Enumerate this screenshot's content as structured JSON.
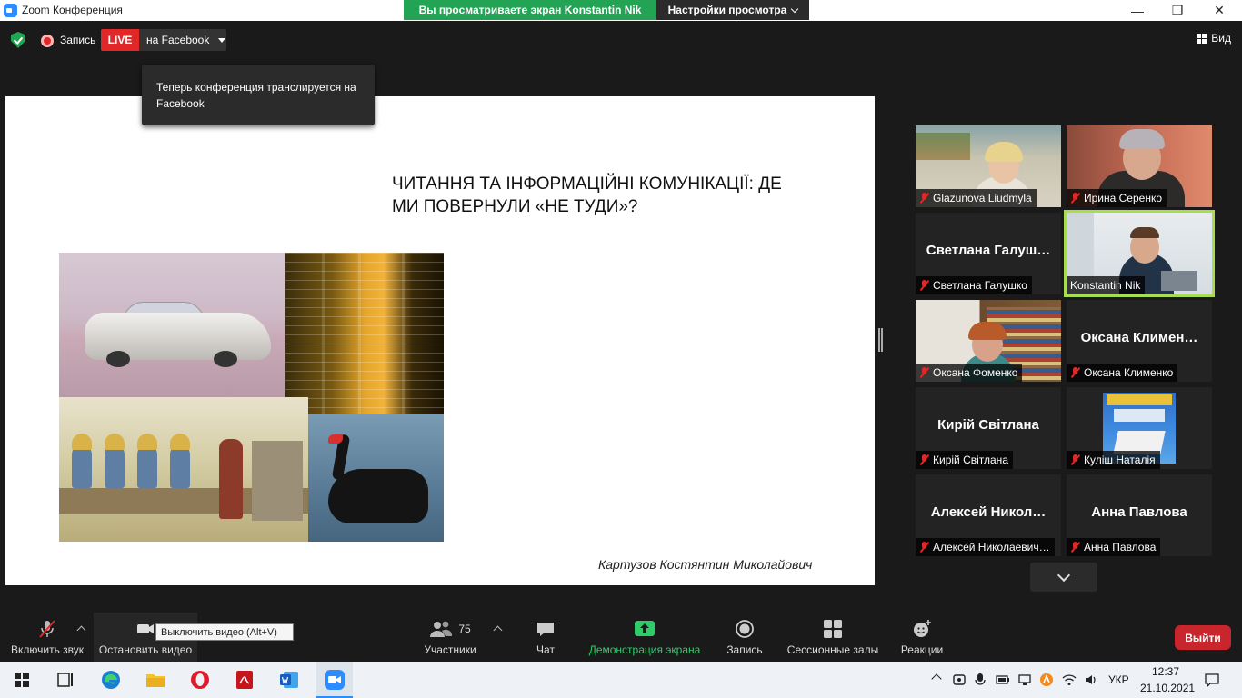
{
  "window": {
    "title": "Zoom Конференция"
  },
  "share_banner": {
    "viewing": "Вы просматриваете экран Konstantin Nik",
    "view_settings": "Настройки просмотра"
  },
  "window_controls": {
    "minimize": "—",
    "maximize": "❐",
    "close": "✕"
  },
  "top_bar": {
    "record_label": "Запись",
    "live_label": "LIVE",
    "live_target": "на Facebook",
    "view_label": "Вид"
  },
  "tooltip": {
    "text": "Теперь конференция транслируется на Facebook"
  },
  "slide": {
    "title": "ЧИТАННЯ ТА ІНФОРМАЦІЙНІ КОМУНІКАЦІЇ: ДЕ МИ ПОВЕРНУЛИ «НЕ ТУДИ»?",
    "author": "Картузов Костянтин Миколайович"
  },
  "participants": [
    {
      "display": "",
      "nametag": "Glazunova Liudmyla",
      "video": true
    },
    {
      "display": "",
      "nametag": "Ирина Серенко",
      "video": true
    },
    {
      "display": "Светлана  Галуш…",
      "nametag": "Светлана Галушко",
      "video": false
    },
    {
      "display": "",
      "nametag": "Konstantin Nik",
      "video": true,
      "active": true
    },
    {
      "display": "",
      "nametag": "Оксана Фоменко",
      "video": true
    },
    {
      "display": "Оксана  Климен…",
      "nametag": "Оксана Клименко",
      "video": false
    },
    {
      "display": "Кирій Світлана",
      "nametag": "Кирій Світлана",
      "video": false
    },
    {
      "display": "",
      "nametag": "Куліш Наталія",
      "video": true
    },
    {
      "display": "Алексей  Никол…",
      "nametag": "Алексей Николаевич…",
      "video": false
    },
    {
      "display": "Анна Павлова",
      "nametag": "Анна Павлова",
      "video": false
    }
  ],
  "toolbar": {
    "unmute": "Включить звук",
    "stop_video": "Остановить видео",
    "video_tooltip": "Выключить видео (Alt+V)",
    "participants": "Участники",
    "participants_count": "75",
    "chat": "Чат",
    "share_screen": "Демонстрация экрана",
    "record": "Запись",
    "breakout": "Сессионные залы",
    "reactions": "Реакции",
    "leave": "Выйти"
  },
  "taskbar": {
    "language": "УКР",
    "time": "12:37",
    "date": "21.10.2021"
  },
  "colors": {
    "live_red": "#e02828",
    "share_green": "#23a455",
    "active_speaker": "#a6dd51",
    "leave_red": "#c8262c"
  }
}
